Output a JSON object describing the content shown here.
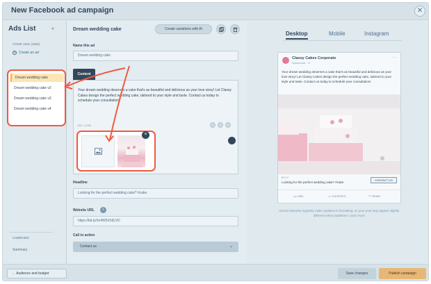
{
  "window": {
    "title": "New Facebook ad campaign",
    "close_icon": "close-icon"
  },
  "sidebar": {
    "title": "Ads List",
    "section_label": "YOUR ADS (4/50)",
    "create_label": "Create an ad",
    "ads": [
      "Dream wedding cake",
      "Dream wedding cake v2",
      "Dream wedding cake v3",
      "Dream wedding cake v4"
    ],
    "active_index": 0,
    "campaign_label": "CAMPAIGN",
    "summary_label": "Summary"
  },
  "editor": {
    "ad_title": "Dream wedding cake",
    "variations_button": "Create variations with AI",
    "name_label": "Name this ad",
    "name_value": "Dream wedding cake",
    "content_tab": "Content",
    "content_text": "Your dream wedding deserves a cake that's as beautiful and delicious as your love story! Let Classy Cakes design the perfect wedding cake, tailored to your style and taste. Contact us today to schedule your consultation!",
    "char_counter": "150 / 1,000",
    "headline_label": "Headline",
    "headline_value": "Looking for the perfect wedding cake? #cake",
    "url_label": "Website URL",
    "url_value": "https://bit.ly/3n4W5Xh5LVD",
    "cta_label": "Call to action",
    "cta_value": "Contact us"
  },
  "preview": {
    "tabs": [
      "Desktop",
      "Mobile",
      "Instagram"
    ],
    "active_tab": 0,
    "page_name": "Classy Cakes Corporate",
    "sponsored": "Sponsored · ⊙",
    "body": "Your dream wedding deserves a cake that's as beautiful and delicious as your love story! Let Classy Cakes design the perfect wedding cake, tailored to your style and taste. Contact us today to schedule your consultation!",
    "domain": "BIT.LY",
    "headline": "Looking for the perfect wedding cake? #cake",
    "cta": "CONTACT US",
    "actions": [
      "Like",
      "Comment",
      "Share"
    ],
    "note": "Social networks regularly make updates to formatting, so your post may appear slightly different when published. Learn more"
  },
  "footer": {
    "back_label": "← Audience and budget",
    "save_label": "Save changes",
    "publish_label": "Publish campaign"
  },
  "colors": {
    "highlight": "#f1583f",
    "accent": "#e8b777",
    "dark": "#33475b"
  }
}
